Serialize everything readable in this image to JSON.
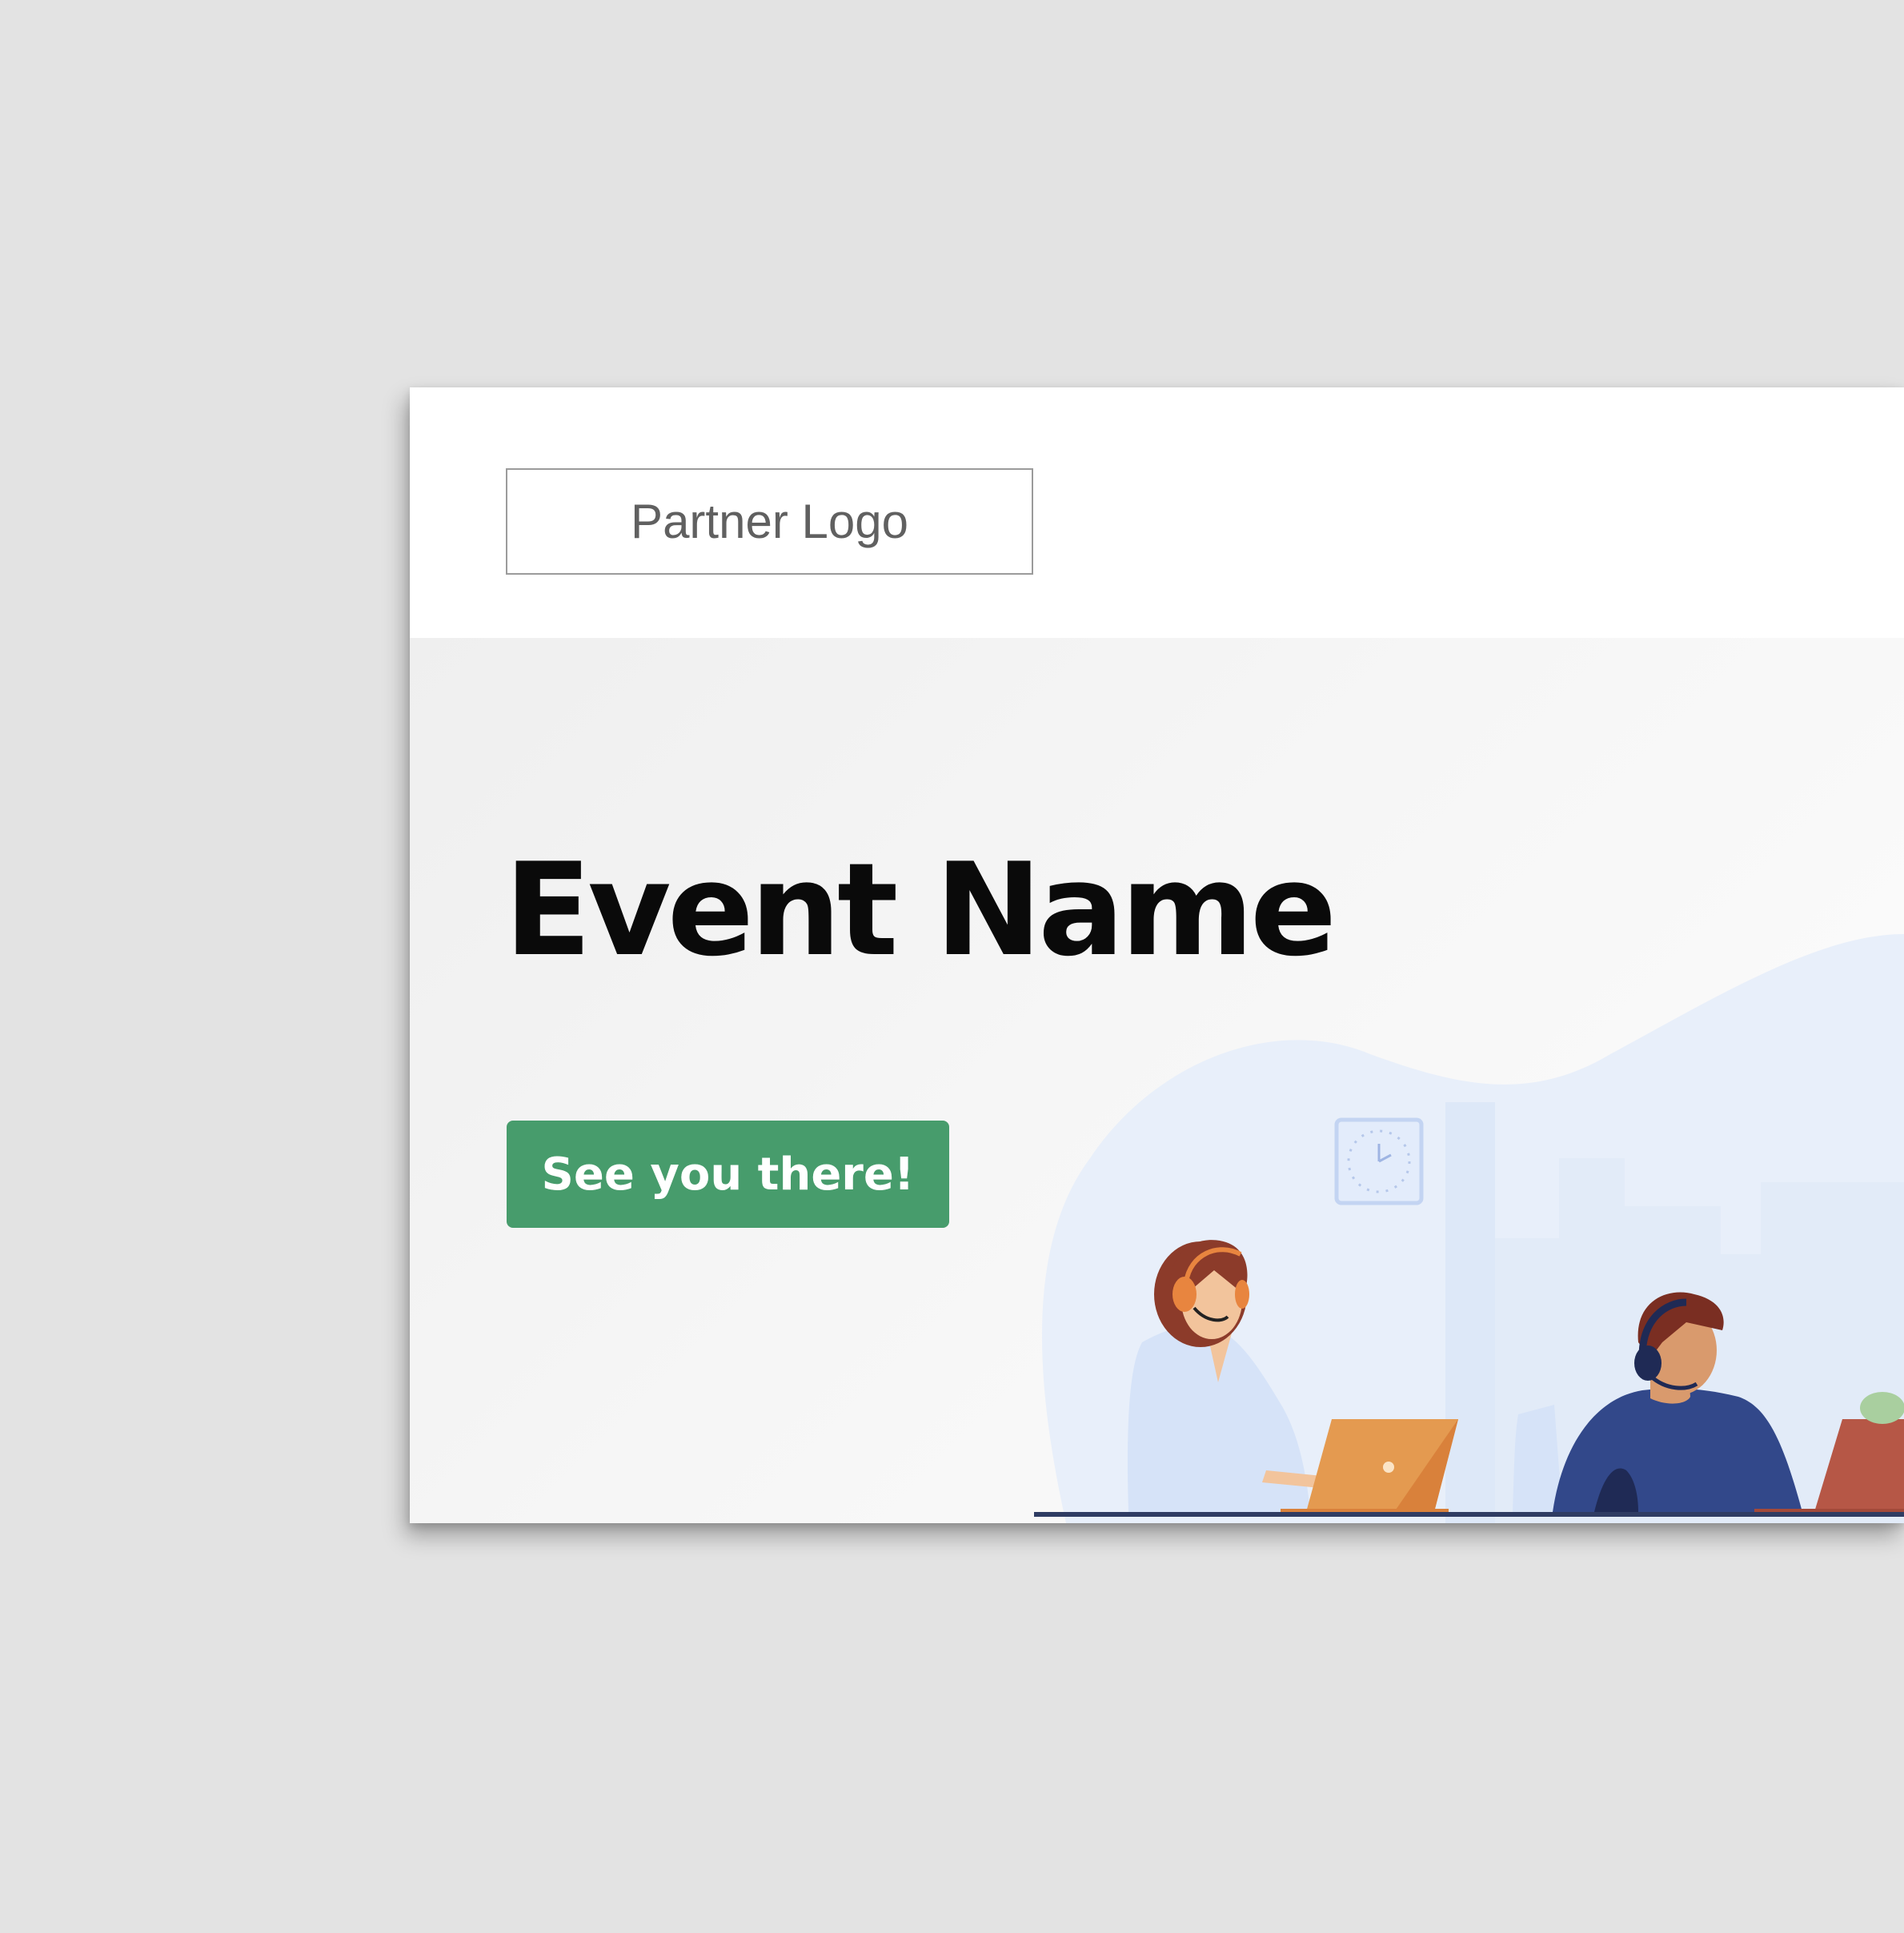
{
  "partner_logo": {
    "label": "Partner Logo"
  },
  "hero": {
    "title": "Event Name",
    "cta_label": "See you there!"
  },
  "colors": {
    "page_background": "#e3e3e3",
    "card_background": "#ffffff",
    "cta_green": "#479c6c",
    "title_text": "#0a0a0a",
    "logo_text": "#606060"
  },
  "icons": [
    "clock-icon"
  ]
}
